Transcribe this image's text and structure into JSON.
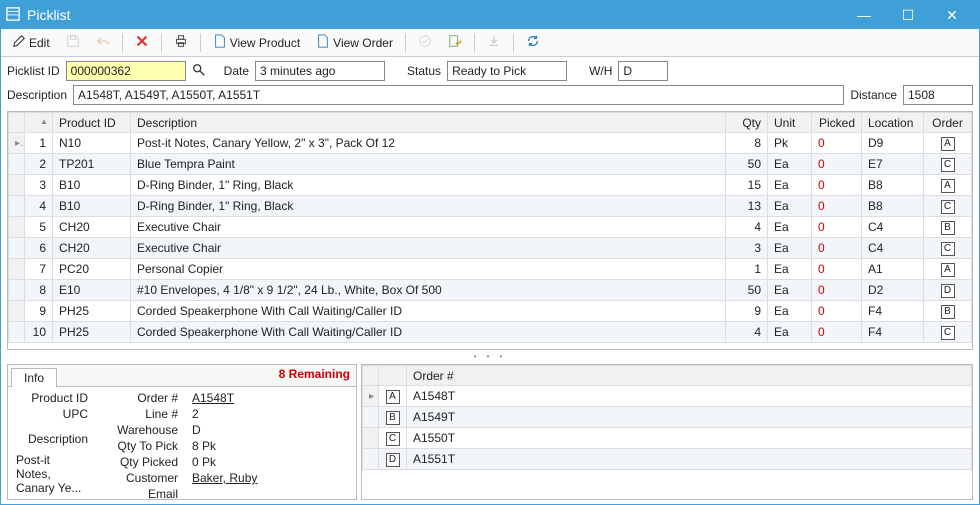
{
  "window": {
    "title": "Picklist"
  },
  "toolbar": {
    "edit": "Edit",
    "view_product": "View Product",
    "view_order": "View Order"
  },
  "filters": {
    "picklist_id_label": "Picklist ID",
    "picklist_id": "000000362",
    "date_label": "Date",
    "date": "3 minutes ago",
    "status_label": "Status",
    "status": "Ready to Pick",
    "wh_label": "W/H",
    "wh": "D",
    "description_label": "Description",
    "description": "A1548T, A1549T, A1550T, A1551T",
    "distance_label": "Distance",
    "distance": "1508"
  },
  "grid": {
    "headers": {
      "row": "",
      "product_id": "Product ID",
      "description": "Description",
      "qty": "Qty",
      "unit": "Unit",
      "picked": "Picked",
      "location": "Location",
      "order": "Order"
    },
    "rows": [
      {
        "n": 1,
        "product_id": "N10",
        "description": "Post-it Notes, Canary Yellow, 2\" x 3\", Pack Of 12",
        "qty": 8,
        "unit": "Pk",
        "picked": 0,
        "location": "D9",
        "order": "A"
      },
      {
        "n": 2,
        "product_id": "TP201",
        "description": "Blue Tempra Paint",
        "qty": 50,
        "unit": "Ea",
        "picked": 0,
        "location": "E7",
        "order": "C"
      },
      {
        "n": 3,
        "product_id": "B10",
        "description": "D-Ring Binder, 1\" Ring, Black",
        "qty": 15,
        "unit": "Ea",
        "picked": 0,
        "location": "B8",
        "order": "A"
      },
      {
        "n": 4,
        "product_id": "B10",
        "description": "D-Ring Binder, 1\" Ring, Black",
        "qty": 13,
        "unit": "Ea",
        "picked": 0,
        "location": "B8",
        "order": "C"
      },
      {
        "n": 5,
        "product_id": "CH20",
        "description": "Executive Chair",
        "qty": 4,
        "unit": "Ea",
        "picked": 0,
        "location": "C4",
        "order": "B"
      },
      {
        "n": 6,
        "product_id": "CH20",
        "description": "Executive Chair",
        "qty": 3,
        "unit": "Ea",
        "picked": 0,
        "location": "C4",
        "order": "C"
      },
      {
        "n": 7,
        "product_id": "PC20",
        "description": "Personal Copier",
        "qty": 1,
        "unit": "Ea",
        "picked": 0,
        "location": "A1",
        "order": "A"
      },
      {
        "n": 8,
        "product_id": "E10",
        "description": "#10 Envelopes, 4 1/8\" x 9 1/2\", 24 Lb., White, Box Of 500",
        "qty": 50,
        "unit": "Ea",
        "picked": 0,
        "location": "D2",
        "order": "D"
      },
      {
        "n": 9,
        "product_id": "PH25",
        "description": "Corded Speakerphone With Call Waiting/Caller ID",
        "qty": 9,
        "unit": "Ea",
        "picked": 0,
        "location": "F4",
        "order": "B"
      },
      {
        "n": 10,
        "product_id": "PH25",
        "description": "Corded Speakerphone With Call Waiting/Caller ID",
        "qty": 4,
        "unit": "Ea",
        "picked": 0,
        "location": "F4",
        "order": "C"
      }
    ]
  },
  "info": {
    "tab": "Info",
    "remaining": "8 Remaining",
    "product_id_label": "Product ID",
    "upc_label": "UPC",
    "description_label": "Description",
    "description_value": "Post-it Notes, Canary Ye...",
    "order_no_label": "Order #",
    "order_no": "A1548T",
    "line_no_label": "Line #",
    "line_no": "2",
    "warehouse_label": "Warehouse",
    "warehouse": "D",
    "qty_to_pick_label": "Qty To Pick",
    "qty_to_pick": "8 Pk",
    "qty_picked_label": "Qty Picked",
    "qty_picked": "0 Pk",
    "customer_label": "Customer",
    "customer": "Baker, Ruby",
    "email_label": "Email"
  },
  "orders": {
    "header": "Order #",
    "rows": [
      {
        "letter": "A",
        "order": "A1548T"
      },
      {
        "letter": "B",
        "order": "A1549T"
      },
      {
        "letter": "C",
        "order": "A1550T"
      },
      {
        "letter": "D",
        "order": "A1551T"
      }
    ]
  }
}
